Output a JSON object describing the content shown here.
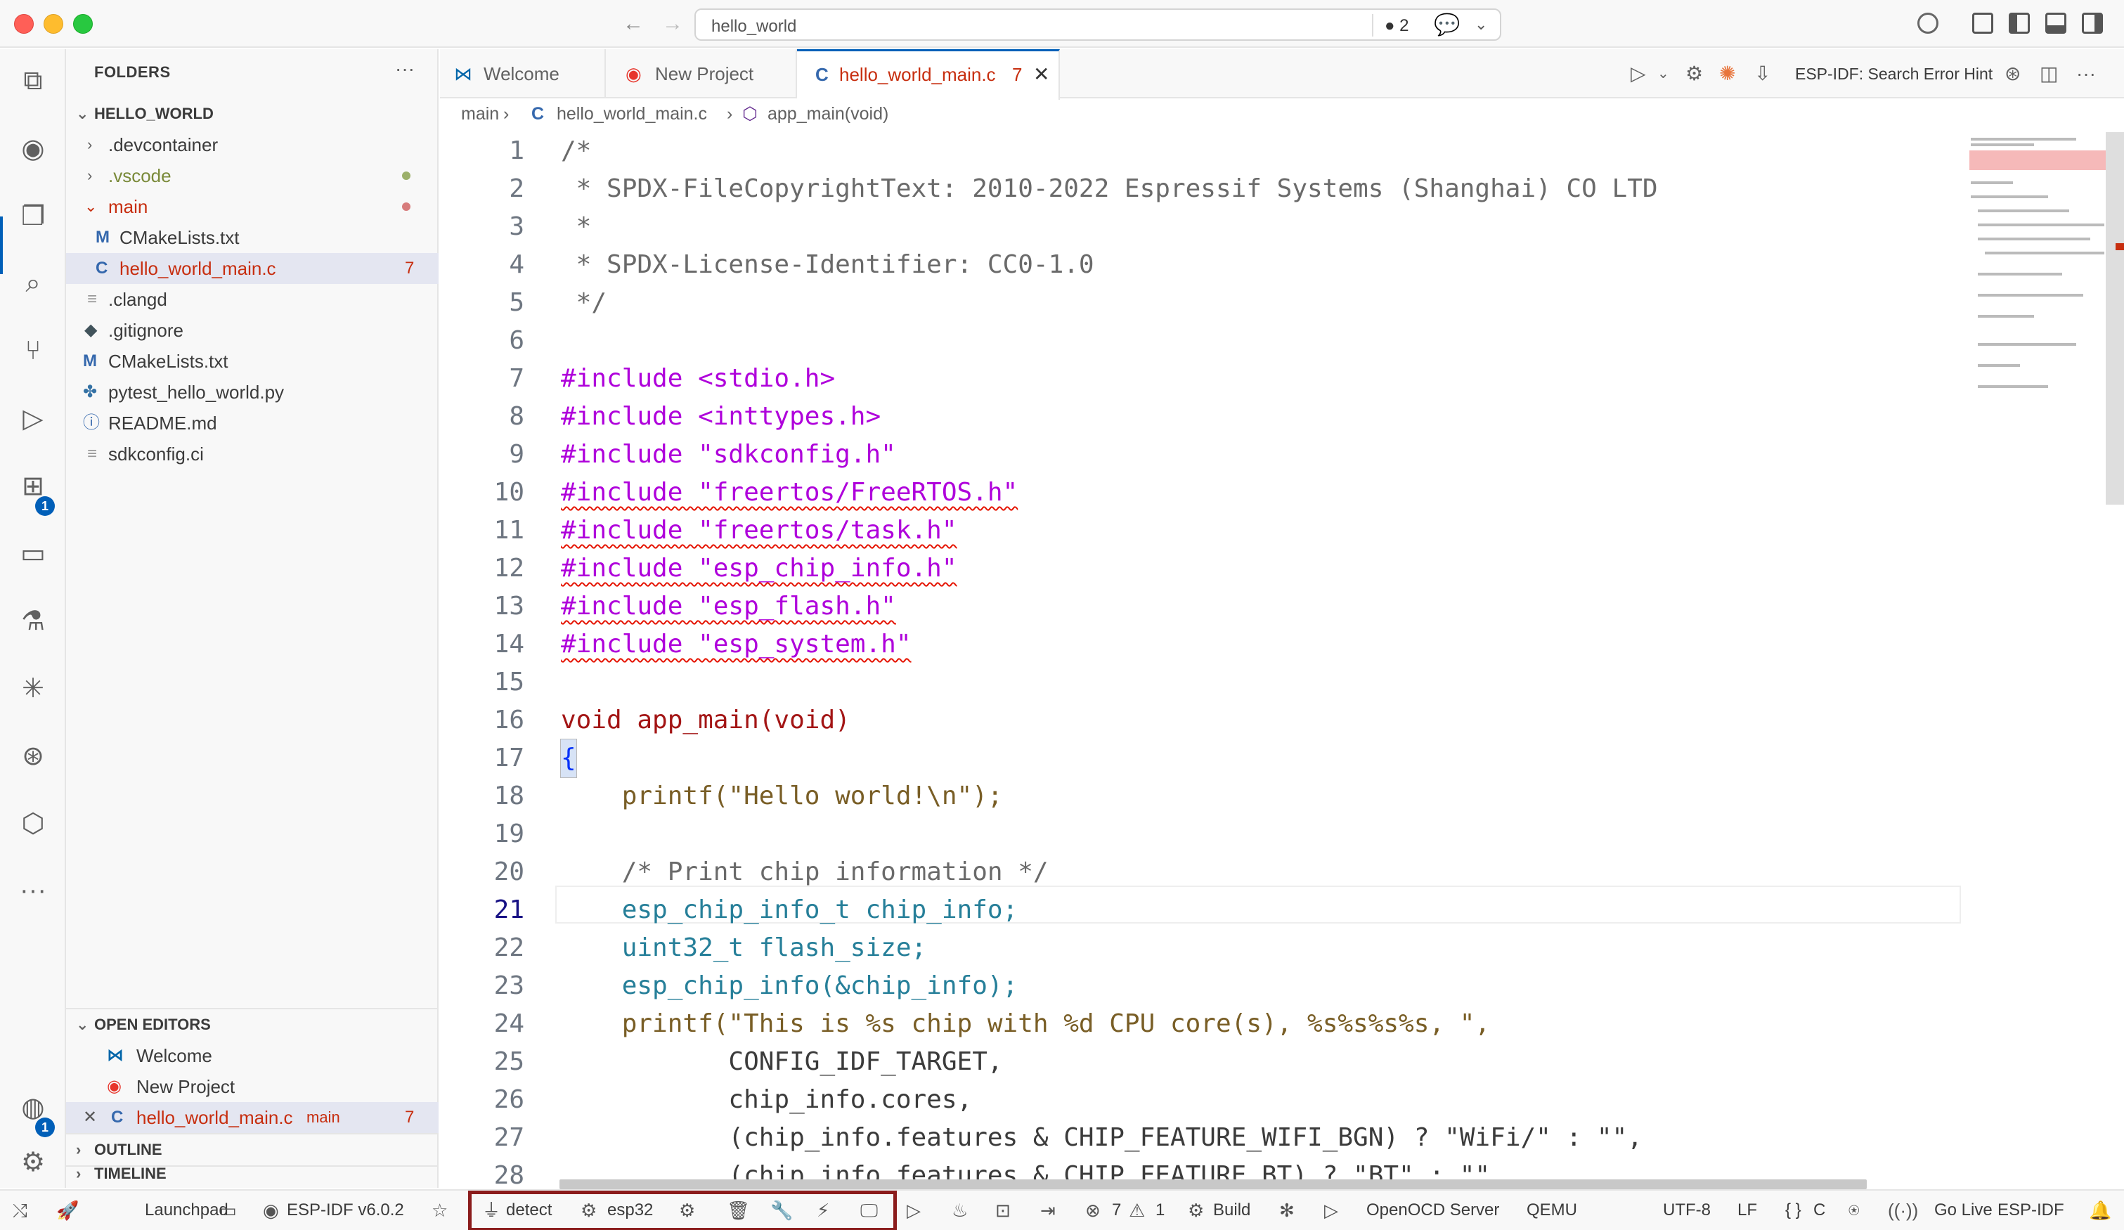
{
  "window": {
    "search_text": "hello_world",
    "notification_count": "2"
  },
  "sidebar": {
    "title": "FOLDERS",
    "root": "HELLO_WORLD",
    "items": [
      {
        "label": ".devcontainer",
        "type": "folder",
        "state": "collapsed"
      },
      {
        "label": ".vscode",
        "type": "folder",
        "state": "collapsed",
        "status": "modified"
      },
      {
        "label": "main",
        "type": "folder",
        "state": "expanded",
        "status": "error"
      },
      {
        "label": "CMakeLists.txt",
        "type": "cmake",
        "icon": "M"
      },
      {
        "label": "hello_world_main.c",
        "type": "c",
        "icon": "C",
        "problems": "7"
      },
      {
        "label": ".clangd",
        "type": "file"
      },
      {
        "label": ".gitignore",
        "type": "git"
      },
      {
        "label": "CMakeLists.txt",
        "type": "cmake",
        "icon": "M"
      },
      {
        "label": "pytest_hello_world.py",
        "type": "python"
      },
      {
        "label": "README.md",
        "type": "info"
      },
      {
        "label": "sdkconfig.ci",
        "type": "file"
      }
    ],
    "open_editors": {
      "title": "OPEN EDITORS",
      "items": [
        {
          "label": "Welcome"
        },
        {
          "label": "New Project"
        },
        {
          "label": "hello_world_main.c",
          "icon": "C",
          "folder": "main",
          "problems": "7"
        }
      ]
    },
    "outline_title": "OUTLINE",
    "timeline_title": "TIMELINE"
  },
  "tabs": [
    {
      "label": "Welcome"
    },
    {
      "label": "New Project"
    },
    {
      "label": "hello_world_main.c",
      "icon": "C",
      "problems": "7",
      "active": true
    }
  ],
  "toolbar": {
    "search_error_hint": "ESP-IDF: Search Error Hint"
  },
  "breadcrumb": {
    "folder": "main",
    "file": "hello_world_main.c",
    "symbol": "app_main(void)"
  },
  "editor": {
    "current_line": "21",
    "line_numbers": [
      "1",
      "2",
      "3",
      "4",
      "5",
      "6",
      "7",
      "8",
      "9",
      "10",
      "11",
      "12",
      "13",
      "14",
      "15",
      "16",
      "17",
      "18",
      "19",
      "20",
      "21",
      "22",
      "23",
      "24",
      "25",
      "26",
      "27",
      "28"
    ],
    "lines": [
      "/*",
      " * SPDX-FileCopyrightText: 2010-2022 Espressif Systems (Shanghai) CO LTD",
      " *",
      " * SPDX-License-Identifier: CC0-1.0",
      " */",
      "",
      "#include <stdio.h>",
      "#include <inttypes.h>",
      "#include \"sdkconfig.h\"",
      "#include \"freertos/FreeRTOS.h\"",
      "#include \"freertos/task.h\"",
      "#include \"esp_chip_info.h\"",
      "#include \"esp_flash.h\"",
      "#include \"esp_system.h\"",
      "",
      "void app_main(void)",
      "{",
      "    printf(\"Hello world!\\n\");",
      "",
      "    /* Print chip information */",
      "    esp_chip_info_t chip_info;",
      "    uint32_t flash_size;",
      "    esp_chip_info(&chip_info);",
      "    printf(\"This is %s chip with %d CPU core(s), %s%s%s%s, \",",
      "           CONFIG_IDF_TARGET,",
      "           chip_info.cores,",
      "           (chip_info.features & CHIP_FEATURE_WIFI_BGN) ? \"WiFi/\" : \"\",",
      "           (chip_info.features & CHIP_FEATURE_BT) ? \"BT\" : \"\","
    ]
  },
  "statusbar": {
    "launchpad": "Launchpad",
    "esp_idf_version": "ESP-IDF v6.0.2",
    "detect": "detect",
    "target": "esp32",
    "errors": "7",
    "warnings": "1",
    "build": "Build",
    "openocd": "OpenOCD Server",
    "qemu": "QEMU",
    "encoding": "UTF-8",
    "eol": "LF",
    "language": "C",
    "go_live": "Go Live",
    "esp_idf": "ESP-IDF"
  },
  "colors": {
    "accent": "#005fb8",
    "error": "#c72e0f",
    "highlight_box": "#8b1c1c"
  }
}
